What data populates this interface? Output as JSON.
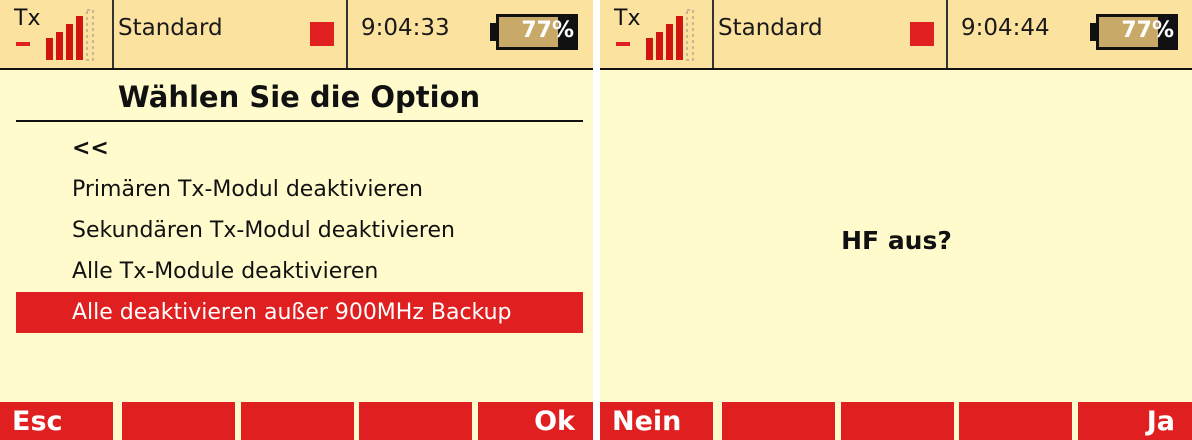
{
  "colors": {
    "accent_red": "#e02020",
    "background": "#fffbcc",
    "statusbar": "#fbe29e",
    "battery_fill": "#c8a968"
  },
  "left_screen": {
    "status": {
      "tx_label": "Tx",
      "model": "Standard",
      "time": "9:04:33",
      "battery": "77%",
      "battery_level": 0.77
    },
    "title": "Wählen Sie die Option",
    "menu": [
      "<<",
      "Primären Tx-Modul deaktivieren",
      "Sekundären Tx-Modul deaktivieren",
      "Alle Tx-Module deaktivieren",
      "Alle deaktivieren außer 900MHz Backup"
    ],
    "selected_index": 4,
    "softkeys": [
      "Esc",
      "",
      "",
      "",
      "Ok"
    ]
  },
  "right_screen": {
    "status": {
      "tx_label": "Tx",
      "model": "Standard",
      "time": "9:04:44",
      "battery": "77%",
      "battery_level": 0.77
    },
    "question": "HF aus?",
    "softkeys": [
      "Nein",
      "",
      "",
      "",
      "Ja"
    ]
  },
  "icons": [
    "signal-bars-icon",
    "record-indicator-icon",
    "battery-icon"
  ]
}
